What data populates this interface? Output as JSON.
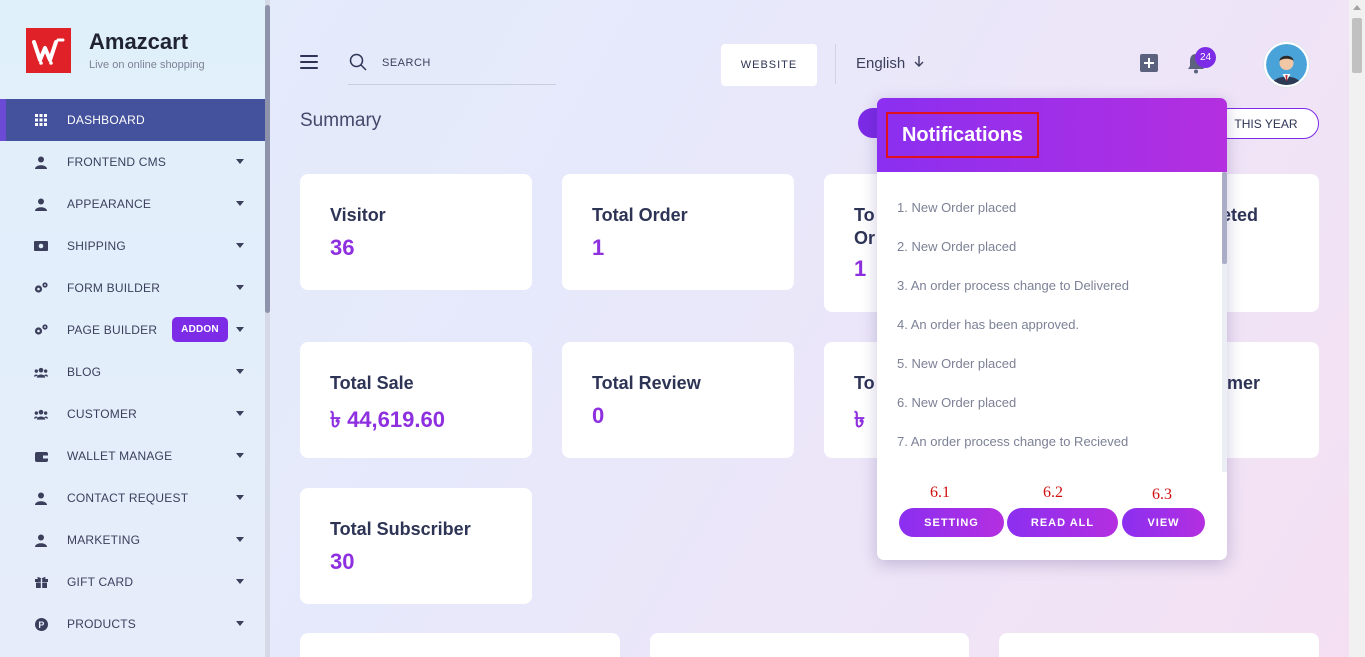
{
  "brand": {
    "name": "Amazcart",
    "tagline": "Live on online shopping"
  },
  "sidebar": {
    "items": [
      {
        "label": "DASHBOARD",
        "icon": "grid-icon"
      },
      {
        "label": "FRONTEND CMS",
        "icon": "user-icon"
      },
      {
        "label": "APPEARANCE",
        "icon": "user-icon"
      },
      {
        "label": "SHIPPING",
        "icon": "money-icon"
      },
      {
        "label": "FORM BUILDER",
        "icon": "gears-icon"
      },
      {
        "label": "PAGE BUILDER",
        "icon": "gears-icon",
        "badge": "ADDON"
      },
      {
        "label": "BLOG",
        "icon": "users-icon"
      },
      {
        "label": "CUSTOMER",
        "icon": "users-icon"
      },
      {
        "label": "WALLET MANAGE",
        "icon": "wallet-icon"
      },
      {
        "label": "CONTACT REQUEST",
        "icon": "user-icon"
      },
      {
        "label": "MARKETING",
        "icon": "user-icon"
      },
      {
        "label": "GIFT CARD",
        "icon": "gift-icon"
      },
      {
        "label": "PRODUCTS",
        "icon": "product-icon"
      }
    ]
  },
  "header": {
    "search_placeholder": "SEARCH",
    "website_label": "WEBSITE",
    "language": "English",
    "notification_count": "24"
  },
  "summary": {
    "title": "Summary",
    "filter_label": "THIS YEAR",
    "cards": {
      "visitor": {
        "title": "Visitor",
        "value": "36"
      },
      "total_order": {
        "title": "Total Order",
        "value": "1"
      },
      "card3": {
        "title": "To… Or…",
        "title_line1": "To",
        "title_line2": "Or",
        "value": "1"
      },
      "card4": {
        "title_fragment": "leted"
      },
      "total_sale": {
        "title": "Total Sale",
        "value": "৳ 44,619.60"
      },
      "total_review": {
        "title": "Total Review",
        "value": "0"
      },
      "card7": {
        "title_fragment": "To",
        "value_fragment": "৳"
      },
      "card8": {
        "title_fragment": "omer"
      },
      "total_subscriber": {
        "title": "Total Subscriber",
        "value": "30"
      }
    }
  },
  "notifications": {
    "title": "Notifications",
    "items": [
      "1. New Order placed",
      "2. New Order placed",
      "3. An order process change to Delivered",
      "4. An order has been approved.",
      "5. New Order placed",
      "6. New Order placed",
      "7. An order process change to Recieved"
    ],
    "buttons": {
      "setting": "SETTING",
      "read_all": "READ ALL",
      "view": "VIEW"
    },
    "annotations": {
      "a1": "6.1",
      "a2": "6.2",
      "a3": "6.3"
    }
  },
  "colors": {
    "accent": "#7c2be6",
    "sidebar_active": "#44519c",
    "logo_red": "#e12128",
    "highlight_box": "#e0101c"
  }
}
